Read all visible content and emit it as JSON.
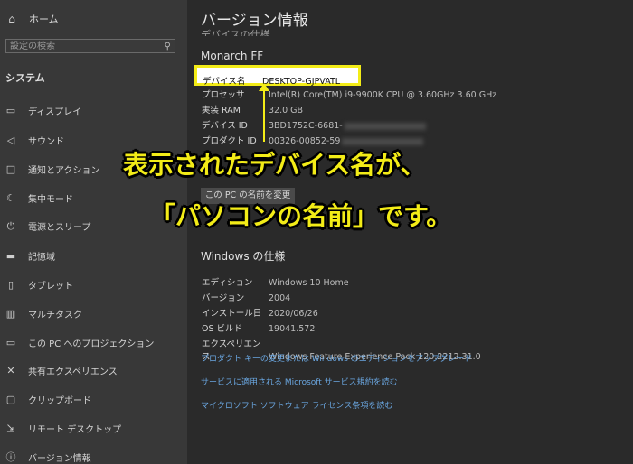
{
  "sidebar": {
    "home": "ホーム",
    "search_placeholder": "設定の検索",
    "section": "システム",
    "items": [
      {
        "label": "ディスプレイ",
        "icon": "display-icon"
      },
      {
        "label": "サウンド",
        "icon": "speaker-icon"
      },
      {
        "label": "通知とアクション",
        "icon": "notification-icon"
      },
      {
        "label": "集中モード",
        "icon": "moon-icon"
      },
      {
        "label": "電源とスリープ",
        "icon": "power-icon"
      },
      {
        "label": "記憶域",
        "icon": "storage-icon"
      },
      {
        "label": "タブレット",
        "icon": "tablet-icon"
      },
      {
        "label": "マルチタスク",
        "icon": "multitask-icon"
      },
      {
        "label": "この PC へのプロジェクション",
        "icon": "projection-icon"
      },
      {
        "label": "共有エクスペリエンス",
        "icon": "share-icon"
      },
      {
        "label": "クリップボード",
        "icon": "clipboard-icon"
      },
      {
        "label": "リモート デスクトップ",
        "icon": "remote-desktop-icon"
      },
      {
        "label": "バージョン情報",
        "icon": "info-icon"
      }
    ]
  },
  "main": {
    "title": "バージョン情報",
    "device_spec_heading": "デバイスの仕様",
    "pc_name": "Monarch FF",
    "device": [
      {
        "label": "デバイス名",
        "value": "DESKTOP-GJPVATL"
      },
      {
        "label": "プロセッサ",
        "value": "Intel(R) Core(TM) i9-9900K CPU @ 3.60GHz   3.60 GHz"
      },
      {
        "label": "実装 RAM",
        "value": "32.0 GB"
      },
      {
        "label": "デバイス ID",
        "value": "3BD1752C-6681-"
      },
      {
        "label": "プロダクト ID",
        "value": "00326-00852-59"
      }
    ],
    "rename_button": "この PC の名前を変更",
    "windows_spec_heading": "Windows の仕様",
    "windows": [
      {
        "label": "エディション",
        "value": "Windows 10 Home"
      },
      {
        "label": "バージョン",
        "value": "2004"
      },
      {
        "label": "インストール日",
        "value": "2020/06/26"
      },
      {
        "label": "OS ビルド",
        "value": "19041.572"
      },
      {
        "label": "エクスペリエンス",
        "value": "Windows Feature Experience Pack 120.2212.31.0"
      }
    ],
    "links": [
      "プロダクト キーの変更または Windows のエディションをアップグレード",
      "サービスに適用される Microsoft サービス規約を読む",
      "マイクロソフト ソフトウェア ライセンス条項を読む"
    ]
  },
  "annotation": {
    "line1": "表示されたデバイス名が、",
    "line2": "「パソコンの名前」です。",
    "color": "#f3ec17"
  }
}
